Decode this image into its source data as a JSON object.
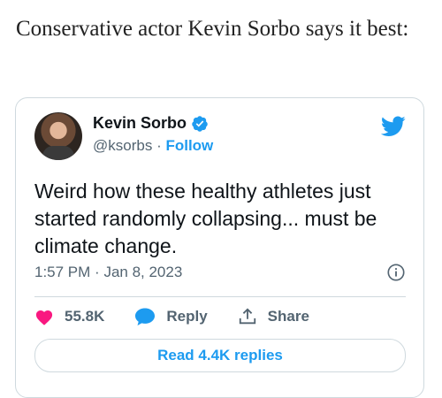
{
  "article": {
    "text": "Conservative actor Kevin Sorbo says it best:"
  },
  "tweet": {
    "author_name": "Kevin Sorbo",
    "handle": "@ksorbs",
    "separator": "·",
    "follow_label": "Follow",
    "text": "Weird how these healthy athletes just started randomly collapsing... must be climate change.",
    "time": "1:57 PM",
    "date": "Jan 8, 2023",
    "like_count": "55.8K",
    "reply_label": "Reply",
    "share_label": "Share",
    "read_replies_label": "Read 4.4K replies"
  },
  "icons": {
    "verified": "verified-badge-icon",
    "brand": "twitter-bird-icon",
    "info": "info-icon",
    "like": "heart-icon",
    "reply": "speech-bubble-icon",
    "share": "share-upload-icon"
  },
  "colors": {
    "accent": "#1d9bf0",
    "like": "#f91880",
    "text": "#0f1419",
    "muted": "#536471",
    "border": "#cfd9de"
  }
}
